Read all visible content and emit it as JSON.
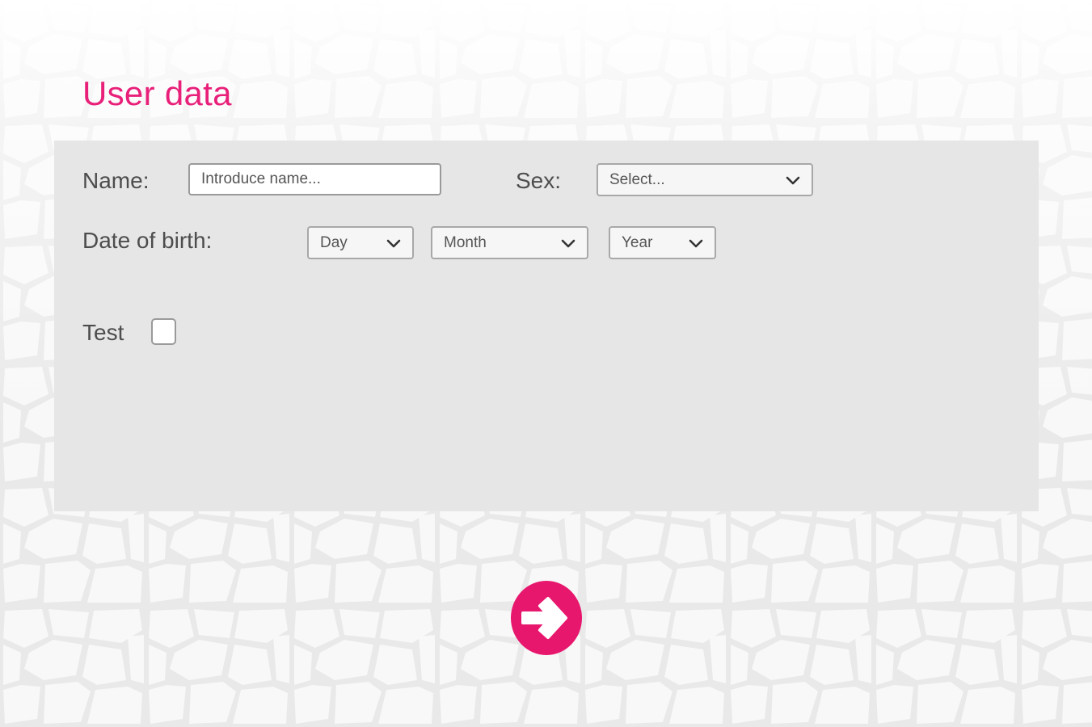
{
  "colors": {
    "accent": "#e8207a",
    "panel": "#e6e6e6",
    "label": "#4d4d4d"
  },
  "page": {
    "title": "User data"
  },
  "form": {
    "name": {
      "label": "Name:",
      "placeholder": "Introduce name...",
      "value": ""
    },
    "sex": {
      "label": "Sex:",
      "selected": "Select..."
    },
    "dob": {
      "label": "Date of birth:",
      "day": "Day",
      "month": "Month",
      "year": "Year"
    },
    "test": {
      "label": "Test",
      "checked": false
    }
  },
  "actions": {
    "next_icon": "arrow-right-icon"
  }
}
